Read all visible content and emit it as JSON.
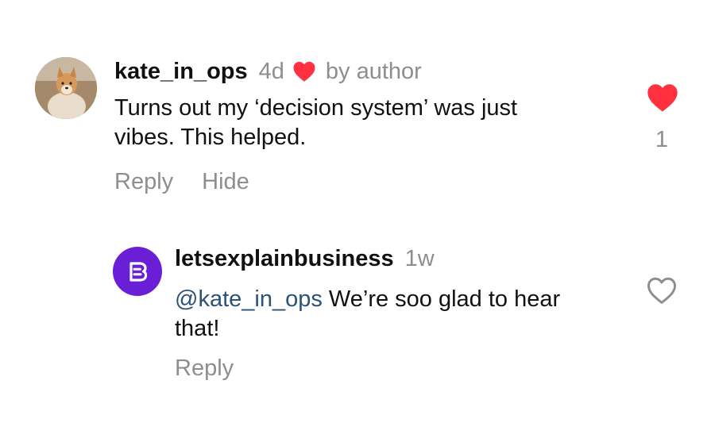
{
  "comment": {
    "username": "kate_in_ops",
    "timestamp": "4d",
    "author_badge": "by author",
    "text": "Turns out my ‘decision system’ was just vibes. This helped.",
    "actions": {
      "reply": "Reply",
      "hide": "Hide"
    },
    "like_count": "1",
    "liked": true,
    "avatar_icon": "dog-photo-avatar"
  },
  "reply": {
    "username": "letsexplainbusiness",
    "timestamp": "1w",
    "mention": "@kate_in_ops",
    "text": " We’re soo glad to hear that!",
    "actions": {
      "reply": "Reply"
    },
    "liked": false,
    "avatar_icon": "brand-logo-avatar"
  },
  "colors": {
    "heart_red": "#ff3040",
    "brand_purple": "#6a1fd6",
    "mention_blue": "#2a5378",
    "muted_gray": "#8e8e8e"
  }
}
